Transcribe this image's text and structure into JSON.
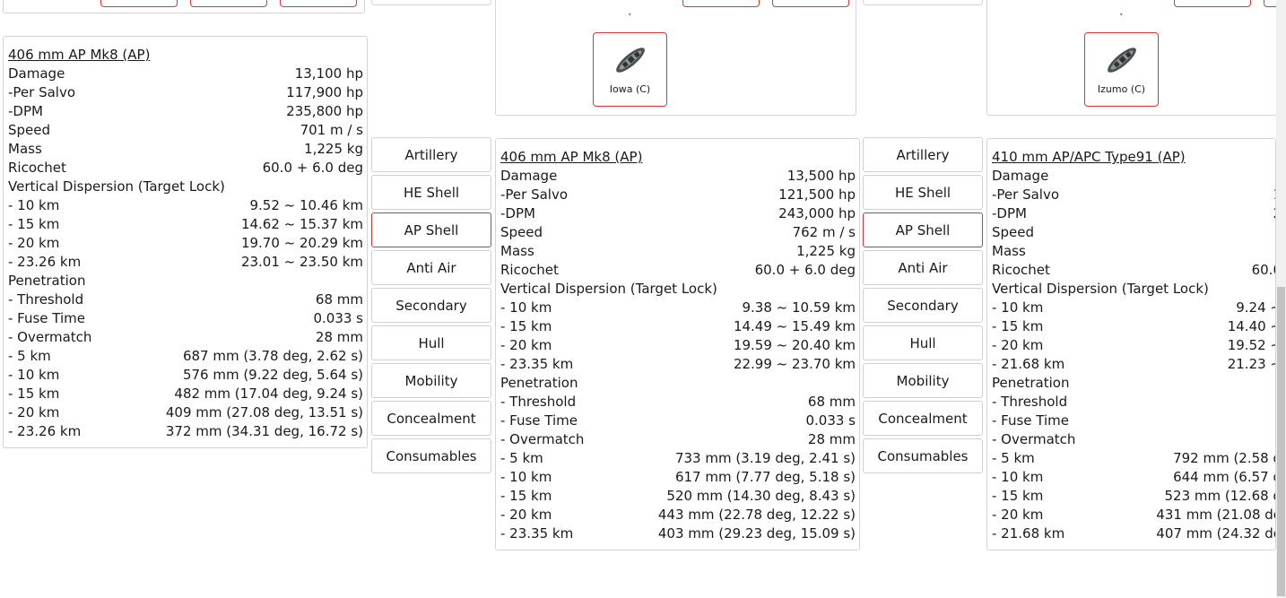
{
  "stats_common": {
    "damage": "Damage",
    "per_salvo": "-Per Salvo",
    "dpm": "-DPM",
    "speed": "Speed",
    "mass": "Mass",
    "ricochet": "Ricochet",
    "vertical_dispersion": "Vertical Dispersion (Target Lock)",
    "penetration": "Penetration",
    "threshold": "- Threshold",
    "fuse_time": "- Fuse Time",
    "overmatch": "- Overmatch"
  },
  "tabs": [
    "Artillery",
    "HE Shell",
    "AP Shell",
    "Anti Air",
    "Secondary",
    "Hull",
    "Mobility",
    "Concealment",
    "Consumables"
  ],
  "active_tab": "AP Shell",
  "panels": [
    {
      "title": "406 mm AP Mk8 (AP)",
      "damage": "13,100 hp",
      "per_salvo": "117,900 hp",
      "dpm": "235,800 hp",
      "speed": "701 m / s",
      "mass": "1,225 kg",
      "ricochet": "60.0 + 6.0 deg",
      "dispersion": [
        {
          "label": "- 10 km",
          "value": "9.52 ~ 10.46 km"
        },
        {
          "label": "- 15 km",
          "value": "14.62 ~ 15.37 km"
        },
        {
          "label": "- 20 km",
          "value": "19.70 ~ 20.29 km"
        },
        {
          "label": "- 23.26 km",
          "value": "23.01 ~ 23.50 km"
        }
      ],
      "threshold": "68 mm",
      "fuse_time": "0.033 s",
      "overmatch": "28 mm",
      "penetration": [
        {
          "label": "- 5 km",
          "value": "687 mm (3.78 deg, 2.62 s)"
        },
        {
          "label": "- 10 km",
          "value": "576 mm (9.22 deg, 5.64 s)"
        },
        {
          "label": "- 15 km",
          "value": "482 mm (17.04 deg, 9.24 s)"
        },
        {
          "label": "- 20 km",
          "value": "409 mm (27.08 deg, 13.51 s)"
        },
        {
          "label": "- 23.26 km",
          "value": "372 mm (34.31 deg, 16.72 s)"
        }
      ]
    },
    {
      "title": "406 mm AP Mk8 (AP)",
      "damage": "13,500 hp",
      "per_salvo": "121,500 hp",
      "dpm": "243,000 hp",
      "speed": "762 m / s",
      "mass": "1,225 kg",
      "ricochet": "60.0 + 6.0 deg",
      "dispersion": [
        {
          "label": "- 10 km",
          "value": "9.38 ~ 10.59 km"
        },
        {
          "label": "- 15 km",
          "value": "14.49 ~ 15.49 km"
        },
        {
          "label": "- 20 km",
          "value": "19.59 ~ 20.40 km"
        },
        {
          "label": "- 23.35 km",
          "value": "22.99 ~ 23.70 km"
        }
      ],
      "threshold": "68 mm",
      "fuse_time": "0.033 s",
      "overmatch": "28 mm",
      "penetration": [
        {
          "label": "- 5 km",
          "value": "733 mm (3.19 deg, 2.41 s)"
        },
        {
          "label": "- 10 km",
          "value": "617 mm (7.77 deg, 5.18 s)"
        },
        {
          "label": "- 15 km",
          "value": "520 mm (14.30 deg, 8.43 s)"
        },
        {
          "label": "- 20 km",
          "value": "443 mm (22.78 deg, 12.22 s)"
        },
        {
          "label": "- 23.35 km",
          "value": "403 mm (29.23 deg, 15.09 s)"
        }
      ]
    },
    {
      "title": "410 mm AP/APC Type91 (AP)",
      "damage": "",
      "per_salvo": "1",
      "dpm": "2",
      "speed": "",
      "mass": "",
      "ricochet": "60.0",
      "dispersion": [
        {
          "label": "- 10 km",
          "value": "9.24 ~"
        },
        {
          "label": "- 15 km",
          "value": "14.40 ~"
        },
        {
          "label": "- 20 km",
          "value": "19.52 ~"
        },
        {
          "label": "- 21.68 km",
          "value": "21.23 ~"
        }
      ],
      "threshold": "",
      "fuse_time": "",
      "overmatch": "",
      "penetration": [
        {
          "label": "- 5 km",
          "value": "792 mm (2.58 d"
        },
        {
          "label": "- 10 km",
          "value": "644 mm (6.57 d"
        },
        {
          "label": "- 15 km",
          "value": "523 mm (12.68 d"
        },
        {
          "label": "- 20 km",
          "value": "431 mm (21.08 de"
        },
        {
          "label": "- 21.68 km",
          "value": "407 mm (24.32 de"
        }
      ]
    }
  ],
  "ships": [
    {
      "name": "Iowa (C)",
      "icon": "battleship-icon"
    },
    {
      "name": "Izumo (C)",
      "icon": "battleship-icon"
    }
  ],
  "caret": "˅"
}
